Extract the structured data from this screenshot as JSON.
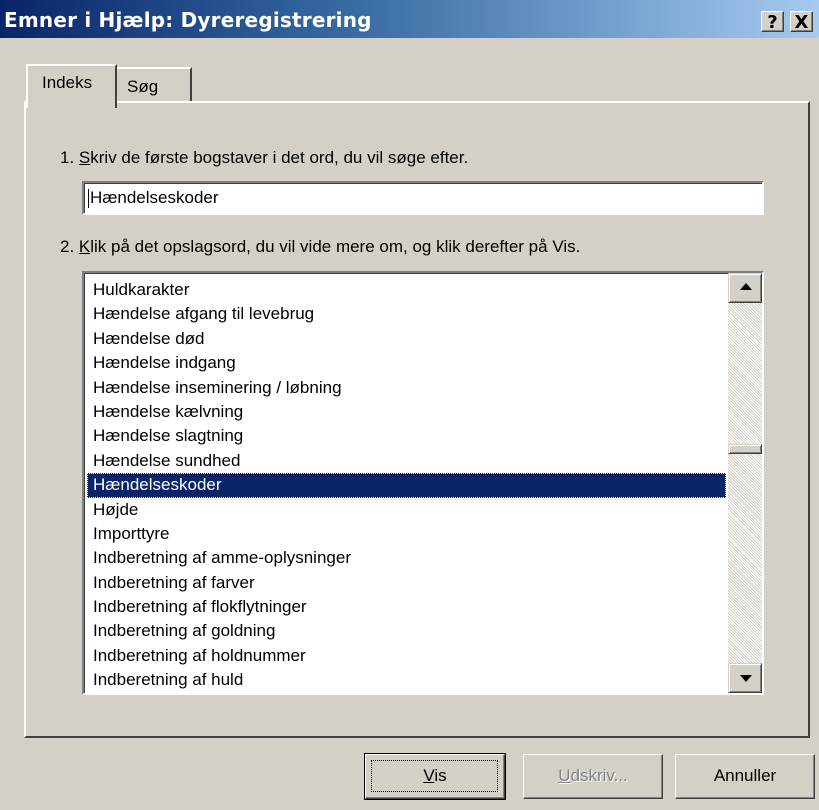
{
  "window": {
    "title": "Emner i Hjælp: Dyreregistrering",
    "help_button": "?",
    "close_button": "X"
  },
  "tabs": [
    {
      "label": "Indeks",
      "active": true
    },
    {
      "label": "Søg",
      "active": false
    }
  ],
  "step1": {
    "number": "1. ",
    "accesskey": "S",
    "rest": "kriv de første bogstaver i det ord, du vil søge efter."
  },
  "search": {
    "value": "Hændelseskoder"
  },
  "step2": {
    "number": "2. ",
    "accesskey": "K",
    "rest": "lik på det opslagsord, du vil vide mere om, og klik derefter på Vis."
  },
  "index_list": {
    "items": [
      "Huldkarakter",
      "Hændelse afgang til levebrug",
      "Hændelse død",
      "Hændelse indgang",
      "Hændelse inseminering  / løbning",
      "Hændelse kælvning",
      "Hændelse slagtning",
      "Hændelse sundhed",
      "Hændelseskoder",
      "Højde",
      "Importtyre",
      "Indberetning af amme-oplysninger",
      "Indberetning af farver",
      "Indberetning af flokflytninger",
      "Indberetning af goldning",
      "Indberetning af holdnummer",
      "Indberetning af huld"
    ],
    "selected": "Hændelseskoder"
  },
  "buttons": {
    "vis": {
      "accesskey": "V",
      "rest": "is"
    },
    "udskriv": {
      "accesskey": "U",
      "rest": "dskriv...",
      "disabled": true
    },
    "annuller": {
      "label": "Annuller"
    }
  }
}
